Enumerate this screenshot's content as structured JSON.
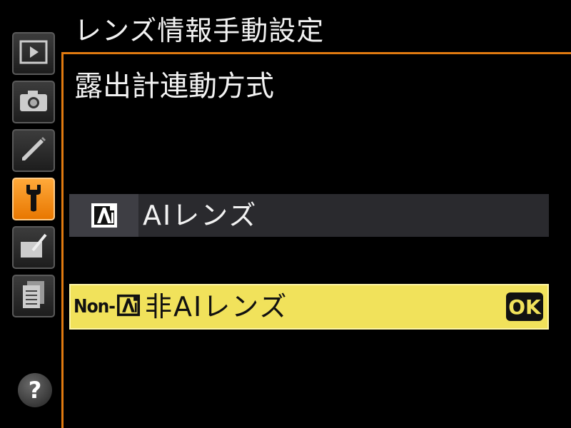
{
  "colors": {
    "accent": "#e07a10",
    "selected_bg": "#f1e25b",
    "row_bg": "#2a2a2e",
    "text": "#f2f2f2"
  },
  "sidebar": {
    "tabs": [
      {
        "icon": "playback-icon",
        "active": false
      },
      {
        "icon": "camera-icon",
        "active": false
      },
      {
        "icon": "pencil-icon",
        "active": false
      },
      {
        "icon": "wrench-icon",
        "active": true
      },
      {
        "icon": "retouch-icon",
        "active": false
      },
      {
        "icon": "my-menu-icon",
        "active": false
      }
    ],
    "help_label": "?"
  },
  "header": {
    "title": "レンズ情報手動設定"
  },
  "panel": {
    "subtitle": "露出計連動方式",
    "options": [
      {
        "icon": "ai-lens-icon",
        "label": "AIレンズ",
        "selected": false
      },
      {
        "icon_prefix": "Non-",
        "icon": "ai-lens-icon",
        "label": "非AIレンズ",
        "selected": true,
        "confirm_label": "OK"
      }
    ]
  }
}
